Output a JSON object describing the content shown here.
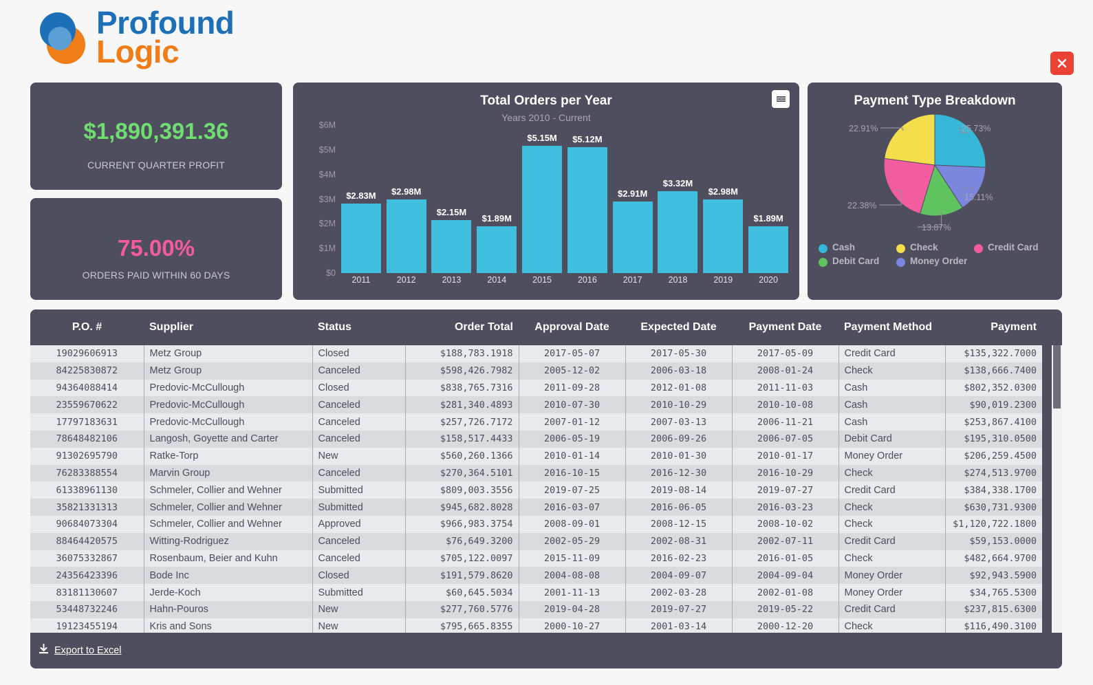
{
  "brand": {
    "line1": "Profound",
    "line2": "Logic",
    "blue": "#1d70b8",
    "orange": "#f07d18"
  },
  "window": {
    "close_label": "close-icon"
  },
  "kpis": [
    {
      "value": "$1,890,391.36",
      "label": "CURRENT QUARTER PROFIT",
      "color": "#6fdd6f"
    },
    {
      "value": "75.00%",
      "label": "ORDERS PAID WITHIN 60 DAYS",
      "color": "#f45ca0"
    }
  ],
  "chart_data": [
    {
      "type": "bar",
      "title": "Total Orders per Year",
      "subtitle": "Years 2010 - Current",
      "xlabel": "",
      "ylabel": "",
      "ylim": [
        0,
        6000000
      ],
      "yticks": [
        "$0",
        "$1M",
        "$2M",
        "$3M",
        "$4M",
        "$5M",
        "$6M"
      ],
      "ytick_values": [
        0,
        1000000,
        2000000,
        3000000,
        4000000,
        5000000,
        6000000
      ],
      "grid": false,
      "bar_color": "#3fbfdd",
      "categories": [
        "2011",
        "2012",
        "2013",
        "2014",
        "2015",
        "2016",
        "2017",
        "2018",
        "2019",
        "2020"
      ],
      "values": [
        2830000,
        2980000,
        2150000,
        1890000,
        5150000,
        5120000,
        2910000,
        3320000,
        2980000,
        1890000
      ],
      "data_labels": [
        "$2.83M",
        "$2.98M",
        "$2.15M",
        "$1.89M",
        "$5.15M",
        "$5.12M",
        "$2.91M",
        "$3.32M",
        "$2.98M",
        "$1.89M"
      ],
      "menu_icon": "hamburger-menu-icon"
    },
    {
      "type": "pie",
      "title": "Payment Type Breakdown",
      "legend_position": "bottom",
      "labels": [
        "Cash",
        "Money Order",
        "Debit Card",
        "Credit Card",
        "Check"
      ],
      "values": [
        25.73,
        15.11,
        13.87,
        22.38,
        22.91
      ],
      "value_labels": [
        "25.73%",
        "15.11%",
        "13.87%",
        "22.38%",
        "22.91%"
      ],
      "colors": [
        "#35b7d8",
        "#7b86de",
        "#5fc45f",
        "#f45ca0",
        "#f4de4b"
      ],
      "legend": [
        {
          "label": "Cash",
          "color": "#35b7d8"
        },
        {
          "label": "Check",
          "color": "#f4de4b"
        },
        {
          "label": "Credit Card",
          "color": "#f45ca0"
        },
        {
          "label": "Debit Card",
          "color": "#5fc45f"
        },
        {
          "label": "Money Order",
          "color": "#7b86de"
        }
      ]
    }
  ],
  "table": {
    "columns": [
      "P.O. #",
      "Supplier",
      "Status",
      "Order Total",
      "Approval Date",
      "Expected Date",
      "Payment Date",
      "Payment Method",
      "Payment"
    ],
    "rows": [
      [
        "19029606913",
        "Metz Group",
        "Closed",
        "$188,783.1918",
        "2017-05-07",
        "2017-05-30",
        "2017-05-09",
        "Credit Card",
        "$135,322.7000"
      ],
      [
        "84225830872",
        "Metz Group",
        "Canceled",
        "$598,426.7982",
        "2005-12-02",
        "2006-03-18",
        "2008-01-24",
        "Check",
        "$138,666.7400"
      ],
      [
        "94364088414",
        "Predovic-McCullough",
        "Closed",
        "$838,765.7316",
        "2011-09-28",
        "2012-01-08",
        "2011-11-03",
        "Cash",
        "$802,352.0300"
      ],
      [
        "23559670622",
        "Predovic-McCullough",
        "Canceled",
        "$281,340.4893",
        "2010-07-30",
        "2010-10-29",
        "2010-10-08",
        "Cash",
        "$90,019.2300"
      ],
      [
        "17797183631",
        "Predovic-McCullough",
        "Canceled",
        "$257,726.7172",
        "2007-01-12",
        "2007-03-13",
        "2006-11-21",
        "Cash",
        "$253,867.4100"
      ],
      [
        "78648482106",
        "Langosh, Goyette and Carter",
        "Canceled",
        "$158,517.4433",
        "2006-05-19",
        "2006-09-26",
        "2006-07-05",
        "Debit Card",
        "$195,310.0500"
      ],
      [
        "91302695790",
        "Ratke-Torp",
        "New",
        "$560,260.1366",
        "2010-01-14",
        "2010-01-30",
        "2010-01-17",
        "Money Order",
        "$206,259.4500"
      ],
      [
        "76283388554",
        "Marvin Group",
        "Canceled",
        "$270,364.5101",
        "2016-10-15",
        "2016-12-30",
        "2016-10-29",
        "Check",
        "$274,513.9700"
      ],
      [
        "61338961130",
        "Schmeler, Collier and Wehner",
        "Submitted",
        "$809,003.3556",
        "2019-07-25",
        "2019-08-14",
        "2019-07-27",
        "Credit Card",
        "$384,338.1700"
      ],
      [
        "35821331313",
        "Schmeler, Collier and Wehner",
        "Submitted",
        "$945,682.8028",
        "2016-03-07",
        "2016-06-05",
        "2016-03-23",
        "Check",
        "$630,731.9300"
      ],
      [
        "90684073304",
        "Schmeler, Collier and Wehner",
        "Approved",
        "$966,983.3754",
        "2008-09-01",
        "2008-12-15",
        "2008-10-02",
        "Check",
        "$1,120,722.1800"
      ],
      [
        "88464420575",
        "Witting-Rodriguez",
        "Canceled",
        "$76,649.3200",
        "2002-05-29",
        "2002-08-31",
        "2002-07-11",
        "Credit Card",
        "$59,153.0000"
      ],
      [
        "36075332867",
        "Rosenbaum, Beier and Kuhn",
        "Canceled",
        "$705,122.0097",
        "2015-11-09",
        "2016-02-23",
        "2016-01-05",
        "Check",
        "$482,664.9700"
      ],
      [
        "24356423396",
        "Bode Inc",
        "Closed",
        "$191,579.8620",
        "2004-08-08",
        "2004-09-07",
        "2004-09-04",
        "Money Order",
        "$92,943.5900"
      ],
      [
        "83181130607",
        "Jerde-Koch",
        "Submitted",
        "$60,645.5034",
        "2001-11-13",
        "2002-03-28",
        "2002-01-08",
        "Money Order",
        "$34,765.5300"
      ],
      [
        "53448732246",
        "Hahn-Pouros",
        "New",
        "$277,760.5776",
        "2019-04-28",
        "2019-07-27",
        "2019-05-22",
        "Credit Card",
        "$237,815.6300"
      ],
      [
        "19123455194",
        "Kris and Sons",
        "New",
        "$795,665.8355",
        "2000-10-27",
        "2001-03-14",
        "2000-12-20",
        "Check",
        "$116,490.3100"
      ]
    ],
    "footer": {
      "export_label": "Export to Excel",
      "export_icon": "download-icon"
    }
  }
}
